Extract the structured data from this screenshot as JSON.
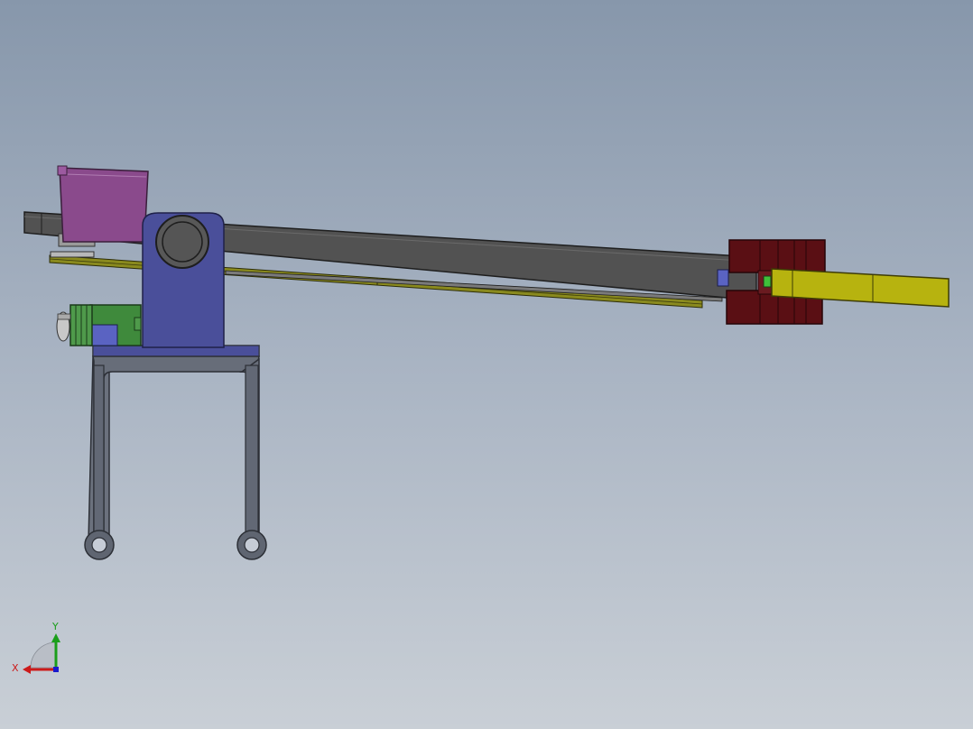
{
  "viewport": {
    "background_top": "#8797ab",
    "background_bottom": "#c9cfd6"
  },
  "model": {
    "parts": [
      {
        "name": "boom-arm",
        "color": "#525252"
      },
      {
        "name": "pivot-bracket",
        "color": "#4a4f9a"
      },
      {
        "name": "support-frame",
        "color": "#5e6470"
      },
      {
        "name": "guide-rail",
        "color": "#8a8a1e"
      },
      {
        "name": "motor-block",
        "color": "#8a4a8c"
      },
      {
        "name": "green-actuator",
        "color": "#3f8a3c"
      },
      {
        "name": "dark-red-clamp",
        "color": "#5a0f14"
      },
      {
        "name": "yellow-tool",
        "color": "#b7b30f"
      }
    ]
  },
  "triad": {
    "x_label": "X",
    "y_label": "Y",
    "x_color": "#cc1a1a",
    "y_color": "#1a9e1a",
    "z_color": "#1a1acc"
  }
}
